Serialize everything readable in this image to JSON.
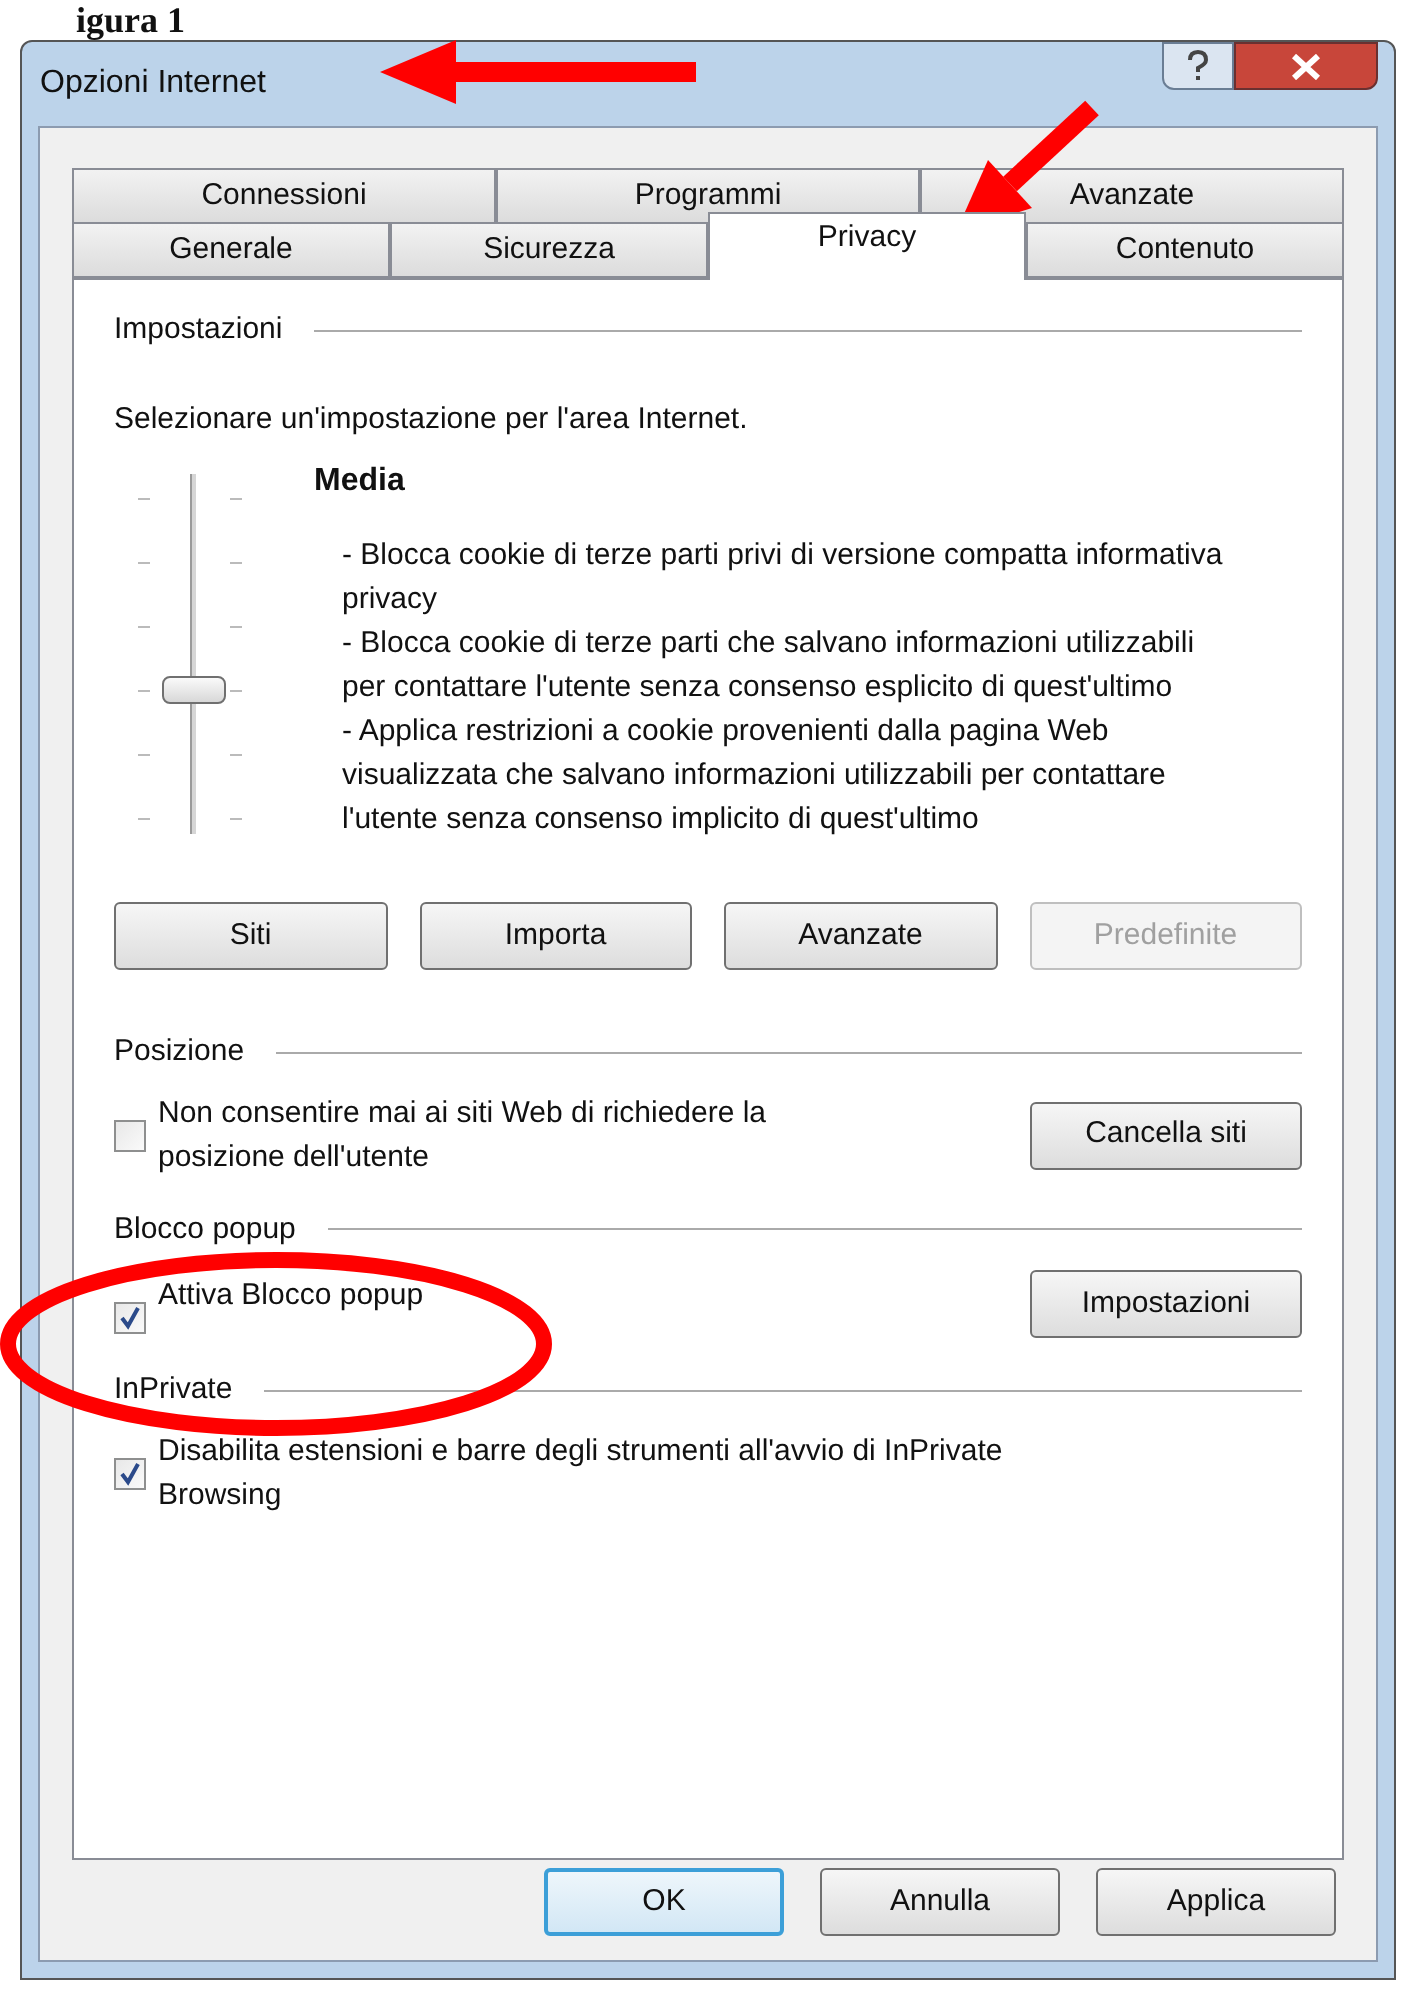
{
  "caption": "igura 1",
  "window": {
    "title": "Opzioni Internet"
  },
  "tab_rows": [
    [
      {
        "label": "Connessioni",
        "selected": false
      },
      {
        "label": "Programmi",
        "selected": false
      },
      {
        "label": "Avanzate",
        "selected": false
      }
    ],
    [
      {
        "label": "Generale",
        "selected": false
      },
      {
        "label": "Sicurezza",
        "selected": false
      },
      {
        "label": "Privacy",
        "selected": true
      },
      {
        "label": "Contenuto",
        "selected": false
      }
    ]
  ],
  "settings": {
    "heading": "Impostazioni",
    "prompt": "Selezionare un'impostazione per l'area Internet.",
    "level_name": "Media",
    "slider": {
      "level": 0.4
    },
    "description": [
      "- Blocca cookie di terze parti privi di versione compatta informativa privacy",
      "- Blocca cookie di terze parti che salvano informazioni utilizzabili per contattare l'utente senza consenso esplicito di quest'ultimo",
      "- Applica restrizioni a cookie provenienti dalla pagina Web visualizzata che salvano informazioni utilizzabili per contattare l'utente senza consenso implicito di quest'ultimo"
    ],
    "buttons": [
      {
        "label": "Siti",
        "disabled": false
      },
      {
        "label": "Importa",
        "disabled": false
      },
      {
        "label": "Avanzate",
        "disabled": false
      },
      {
        "label": "Predefinite",
        "disabled": true
      }
    ]
  },
  "sections": [
    {
      "heading": "Posizione",
      "checkbox": {
        "label": "Non consentire mai ai siti Web di richiedere la posizione dell'utente",
        "checked": false
      },
      "button": "Cancella siti"
    },
    {
      "heading": "Blocco popup",
      "checkbox": {
        "label": "Attiva Blocco popup",
        "checked": true
      },
      "button": "Impostazioni"
    },
    {
      "heading": "InPrivate",
      "checkbox": {
        "label": "Disabilita estensioni e barre degli strumenti all'avvio di InPrivate Browsing",
        "checked": true
      }
    }
  ],
  "dialog_buttons": [
    {
      "label": "OK",
      "default": true
    },
    {
      "label": "Annulla",
      "default": false
    },
    {
      "label": "Applica",
      "default": false
    }
  ]
}
